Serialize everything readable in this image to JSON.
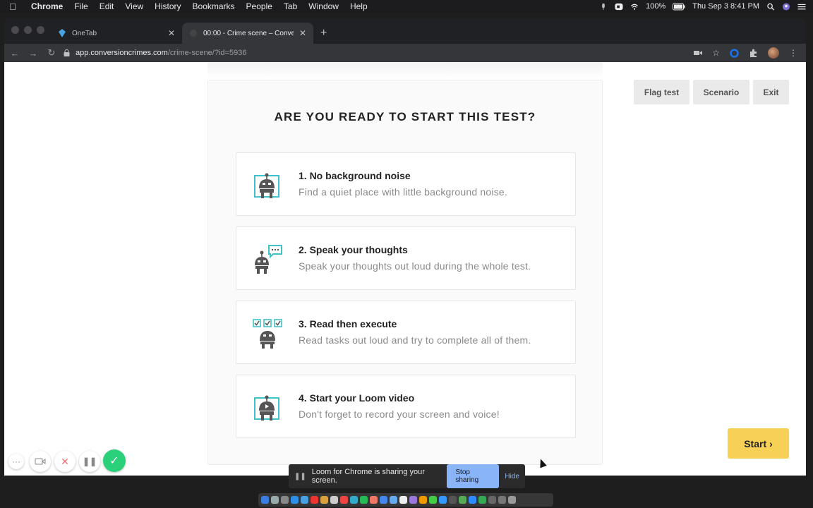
{
  "menubar": {
    "app": "Chrome",
    "items": [
      "File",
      "Edit",
      "View",
      "History",
      "Bookmarks",
      "People",
      "Tab",
      "Window",
      "Help"
    ],
    "battery": "100%",
    "clock": "Thu Sep 3  8:41 PM"
  },
  "browser": {
    "tabs": [
      {
        "title": "OneTab",
        "icon": "onetab-icon"
      },
      {
        "title": "00:00 - Crime scene – Convers",
        "icon": "page-icon"
      }
    ],
    "url_host": "app.conversioncrimes.com",
    "url_path": "/crime-scene/?id=5936"
  },
  "page": {
    "heading": "ARE YOU READY TO START THIS TEST?",
    "items": [
      {
        "title": "1. No background noise",
        "desc": "Find a quiet place with little background noise.",
        "icon": "robot-quiet-icon"
      },
      {
        "title": "2. Speak your thoughts",
        "desc": "Speak your thoughts out loud during the whole test.",
        "icon": "robot-speech-icon"
      },
      {
        "title": "3. Read then execute",
        "desc": "Read tasks out loud and try to complete all of them.",
        "icon": "robot-checklist-icon"
      },
      {
        "title": "4. Start your Loom video",
        "desc": "Don't forget to record your screen and voice!",
        "icon": "robot-video-icon"
      }
    ],
    "buttons": {
      "flag": "Flag test",
      "scenario": "Scenario",
      "exit": "Exit",
      "start": "Start"
    }
  },
  "loom": {
    "share_text": "Loom for Chrome is sharing your screen.",
    "stop_label": "Stop sharing",
    "hide_label": "Hide"
  },
  "colors": {
    "accent_start": "#f7d155",
    "loom_green": "#2ad07a",
    "robot_teal": "#3fc1c9"
  }
}
